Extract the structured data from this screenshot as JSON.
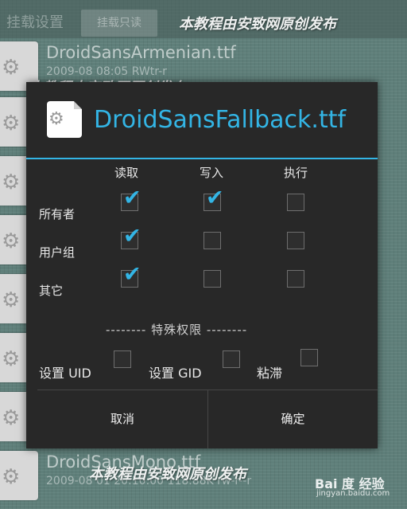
{
  "background": {
    "toolbar": {
      "label": "挂载设置",
      "button_label": "挂载只读"
    },
    "files": [
      {
        "name": "DroidSansArmenian.ttf",
        "meta": "2009-08 08:05 RWtr-r"
      },
      {
        "name": "",
        "meta": ""
      },
      {
        "name": "",
        "meta": ""
      },
      {
        "name": "",
        "meta": ""
      },
      {
        "name": "",
        "meta": ""
      },
      {
        "name": "",
        "meta": ""
      },
      {
        "name": "",
        "meta": ""
      },
      {
        "name": "DroidSansMono.ttf",
        "meta": "2009-08 01 20:10:00 118.88K rw-r--r"
      }
    ]
  },
  "watermarks": [
    "本教程由安致网原创发布",
    "本教程由安致网原创发布",
    "本教程由安致网原创发布"
  ],
  "dialog": {
    "title": "DroidSansFallback.ttf",
    "icon": "file-gear-icon",
    "columns": [
      "读取",
      "写入",
      "执行"
    ],
    "rows": [
      {
        "label": "所有者",
        "read": true,
        "write": true,
        "execute": false
      },
      {
        "label": "用户组",
        "read": true,
        "write": false,
        "execute": false
      },
      {
        "label": "其它",
        "read": true,
        "write": false,
        "execute": false
      }
    ],
    "special_header": "-------- 特殊权限 --------",
    "special": [
      {
        "label": "设置 UID",
        "checked": false
      },
      {
        "label": "设置 GID",
        "checked": false
      },
      {
        "label": "粘滞",
        "checked": false
      }
    ],
    "cancel_label": "取消",
    "ok_label": "确定"
  },
  "logo": {
    "text": "Bai 度 经验",
    "url": "jingyan.baidu.com"
  },
  "colors": {
    "accent": "#33b5e5",
    "dialog_bg": "#282828"
  }
}
